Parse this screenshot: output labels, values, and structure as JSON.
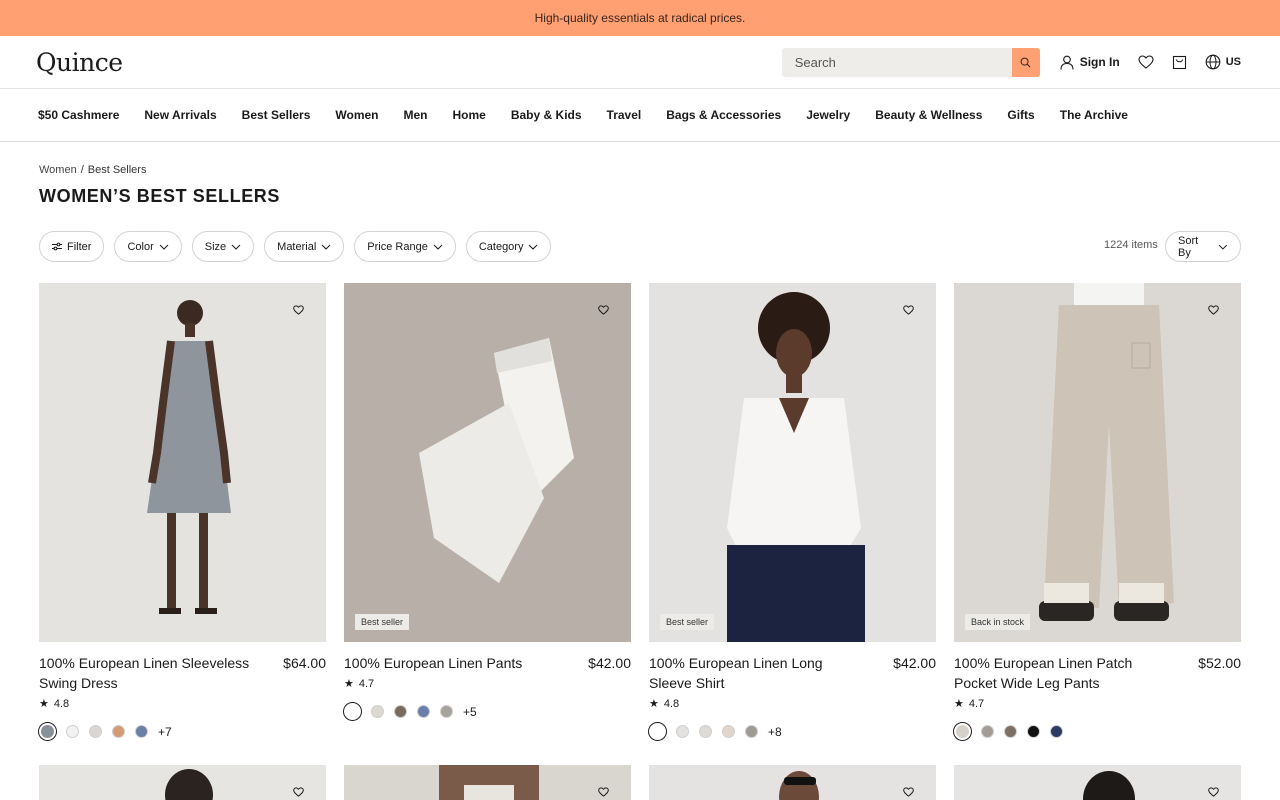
{
  "promo": "High-quality essentials at radical prices.",
  "header": {
    "logo": "Quince",
    "search_placeholder": "Search",
    "signin": "Sign In",
    "region": "US"
  },
  "nav": [
    "$50 Cashmere",
    "New Arrivals",
    "Best Sellers",
    "Women",
    "Men",
    "Home",
    "Baby & Kids",
    "Travel",
    "Bags & Accessories",
    "Jewelry",
    "Beauty & Wellness",
    "Gifts",
    "The Archive"
  ],
  "breadcrumb": {
    "parent": "Women",
    "sep": "/",
    "current": "Best Sellers"
  },
  "title": "WOMEN’S BEST SELLERS",
  "filters": [
    "Filter",
    "Color",
    "Size",
    "Material",
    "Price Range",
    "Category"
  ],
  "item_count": "1224 items",
  "sort_label": "Sort By",
  "colors": {
    "accent": "#ffa073",
    "text": "#1a1a1a"
  },
  "products": [
    {
      "name": "100% European Linen Sleeveless Swing Dress",
      "price": "$64.00",
      "rating": "4.8",
      "badge": "",
      "swatches": [
        "#8a9098",
        "#f2f2f2",
        "#d9d6d2",
        "#d49a74",
        "#6b7ea8"
      ],
      "more": "+7"
    },
    {
      "name": "100% European Linen Pants",
      "price": "$42.00",
      "rating": "4.7",
      "badge": "Best seller",
      "swatches": [
        "#ffffff",
        "#dcd8d2",
        "#7a6a5e",
        "#6a7fad",
        "#a8a29c"
      ],
      "more": "+5"
    },
    {
      "name": "100% European Linen Long Sleeve Shirt",
      "price": "$42.00",
      "rating": "4.8",
      "badge": "Best seller",
      "swatches": [
        "#ffffff",
        "#e4e2e0",
        "#dedad6",
        "#e2d6cc",
        "#a09a94"
      ],
      "more": "+8"
    },
    {
      "name": "100% European Linen Patch Pocket Wide Leg Pants",
      "price": "$52.00",
      "rating": "4.7",
      "badge": "Back in stock",
      "swatches": [
        "#d6d1cb",
        "#a39c95",
        "#7d6f64",
        "#111111",
        "#2c3a63"
      ],
      "more": ""
    }
  ]
}
